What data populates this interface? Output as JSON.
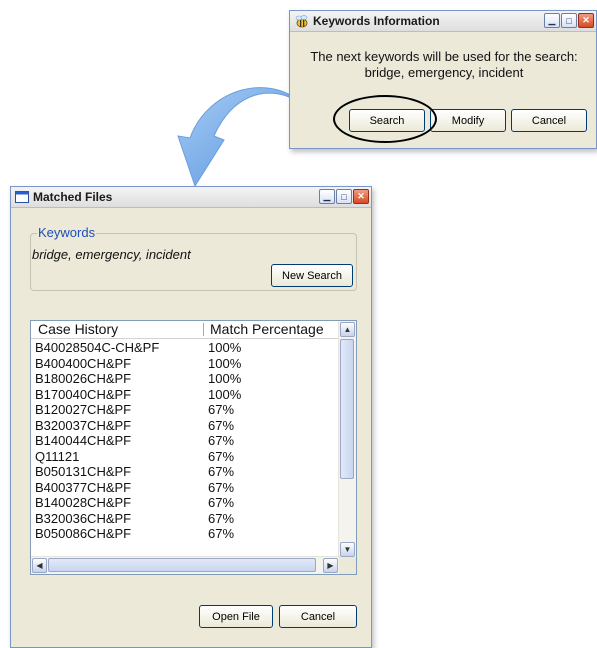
{
  "keywords_dialog": {
    "title": "Keywords Information",
    "message_line1": "The next keywords will be used for the search:",
    "message_line2": "bridge, emergency, incident",
    "buttons": {
      "search": "Search",
      "modify": "Modify",
      "cancel": "Cancel"
    }
  },
  "matched_files": {
    "title": "Matched Files",
    "keywords_group_label": "Keywords",
    "keywords_value": "bridge, emergency, incident",
    "new_search_label": "New Search",
    "columns": [
      "Case History",
      "Match Percentage"
    ],
    "rows": [
      {
        "case": "B40028504C-CH&PF",
        "match": "100%"
      },
      {
        "case": "B400400CH&PF",
        "match": "100%"
      },
      {
        "case": "B180026CH&PF",
        "match": "100%"
      },
      {
        "case": "B170040CH&PF",
        "match": "100%"
      },
      {
        "case": "B120027CH&PF",
        "match": "67%"
      },
      {
        "case": "B320037CH&PF",
        "match": "67%"
      },
      {
        "case": "B140044CH&PF",
        "match": "67%"
      },
      {
        "case": "Q11121",
        "match": "67%"
      },
      {
        "case": "B050131CH&PF",
        "match": "67%"
      },
      {
        "case": "B400377CH&PF",
        "match": "67%"
      },
      {
        "case": "B140028CH&PF",
        "match": "67%"
      },
      {
        "case": "B320036CH&PF",
        "match": "67%"
      },
      {
        "case": "B050086CH&PF",
        "match": "67%"
      }
    ],
    "buttons": {
      "open_file": "Open File",
      "cancel": "Cancel"
    }
  },
  "colors": {
    "arrow": "#6fa8e8",
    "legend": "#1c4fb8",
    "close_button": "#d64b24"
  }
}
